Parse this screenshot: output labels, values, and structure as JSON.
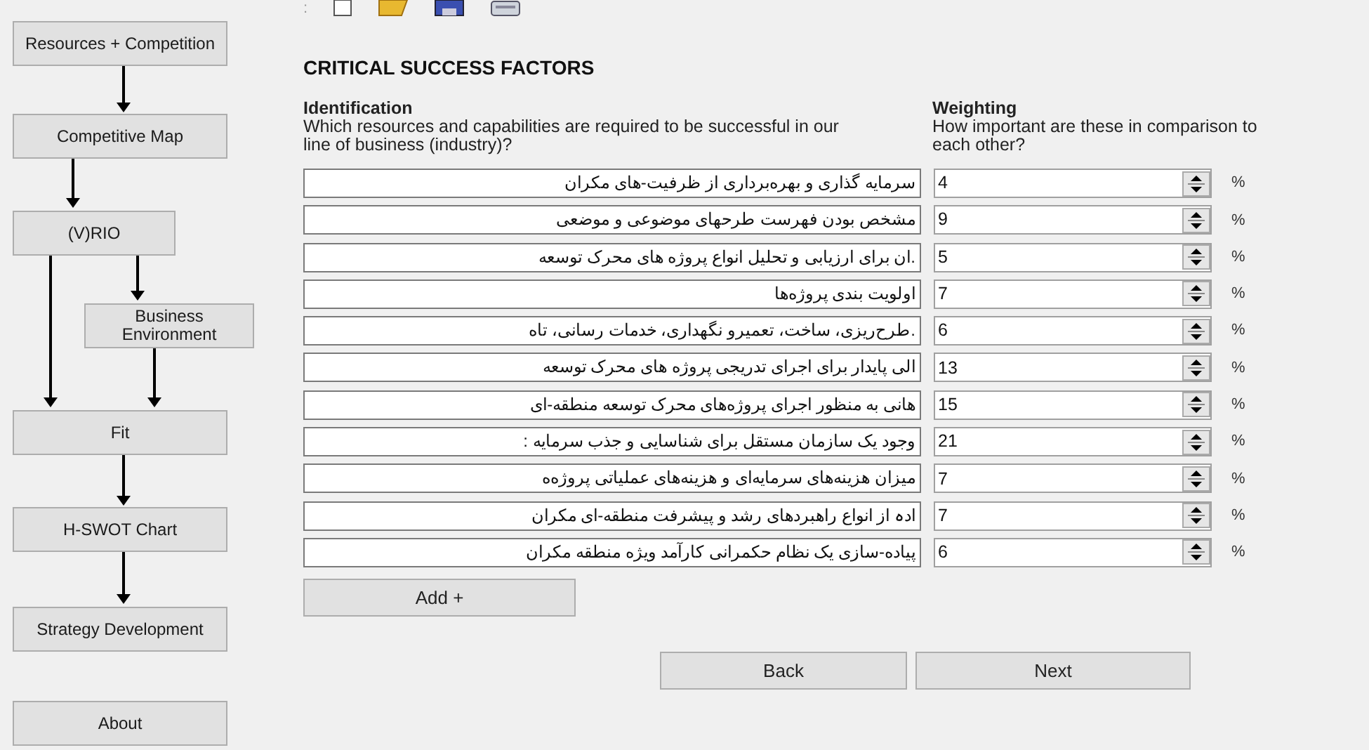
{
  "flowchart": {
    "nodes": [
      {
        "label": "Resources + Competition"
      },
      {
        "label": "Competitive Map"
      },
      {
        "label": "(V)RIO"
      },
      {
        "label": "Business Environment"
      },
      {
        "label": "Fit"
      },
      {
        "label": "H-SWOT Chart"
      },
      {
        "label": "Strategy Development"
      },
      {
        "label": "About"
      }
    ]
  },
  "toolbar": {
    "grip": ":"
  },
  "title": "CRITICAL SUCCESS FACTORS",
  "identification": {
    "heading": "Identification",
    "question": "Which resources and capabilities are required to be successful in our line of business (industry)?"
  },
  "weighting": {
    "heading": "Weighting",
    "question": "How important are these in comparison to each other?"
  },
  "factors": [
    {
      "text": "سرمایه گذاری و بهره‌برداری از ظرفیت-های مکران",
      "weight": "4",
      "unit": "%"
    },
    {
      "text": "مشخص بودن فهرست طرحهای موضوعی و موضعی",
      "weight": "9",
      "unit": "%"
    },
    {
      "text": ".ان برای ارزیابی و تحلیل انواع پروژه های محرک توسعه",
      "weight": "5",
      "unit": "%"
    },
    {
      "text": "اولویت بندی پروژه‌ها",
      "weight": "7",
      "unit": "%"
    },
    {
      "text": ".طرح‌ریزی، ساخت، تعمیرو نگهداری، خدمات رسانی، تاه",
      "weight": "6",
      "unit": "%"
    },
    {
      "text": "الی پایدار  برای اجرای تدریجی پروژه های محرک توسعه",
      "weight": "13",
      "unit": "%"
    },
    {
      "text": "هانی به منظور اجرای پروژه‌های محرک توسعه منطقه-ای",
      "weight": "15",
      "unit": "%"
    },
    {
      "text": "وجود یک سازمان مستقل برای شناسایی و جذب سرمایه :",
      "weight": "21",
      "unit": "%"
    },
    {
      "text": "میزان هزینه‌های سرمایه‌ای و هزینه‌های عملیاتی پروژه‌ه",
      "weight": "7",
      "unit": "%"
    },
    {
      "text": "ادہ از انواع راهبردهای رشد و پیشرفت منطقه-ای مکران",
      "weight": "7",
      "unit": "%"
    },
    {
      "text": "پیاده-سازی یک نظام حکمرانی کارآمد ویژه منطقه مکران",
      "weight": "6",
      "unit": "%"
    }
  ],
  "add_button": "Add +",
  "back_button": "Back",
  "next_button": "Next"
}
